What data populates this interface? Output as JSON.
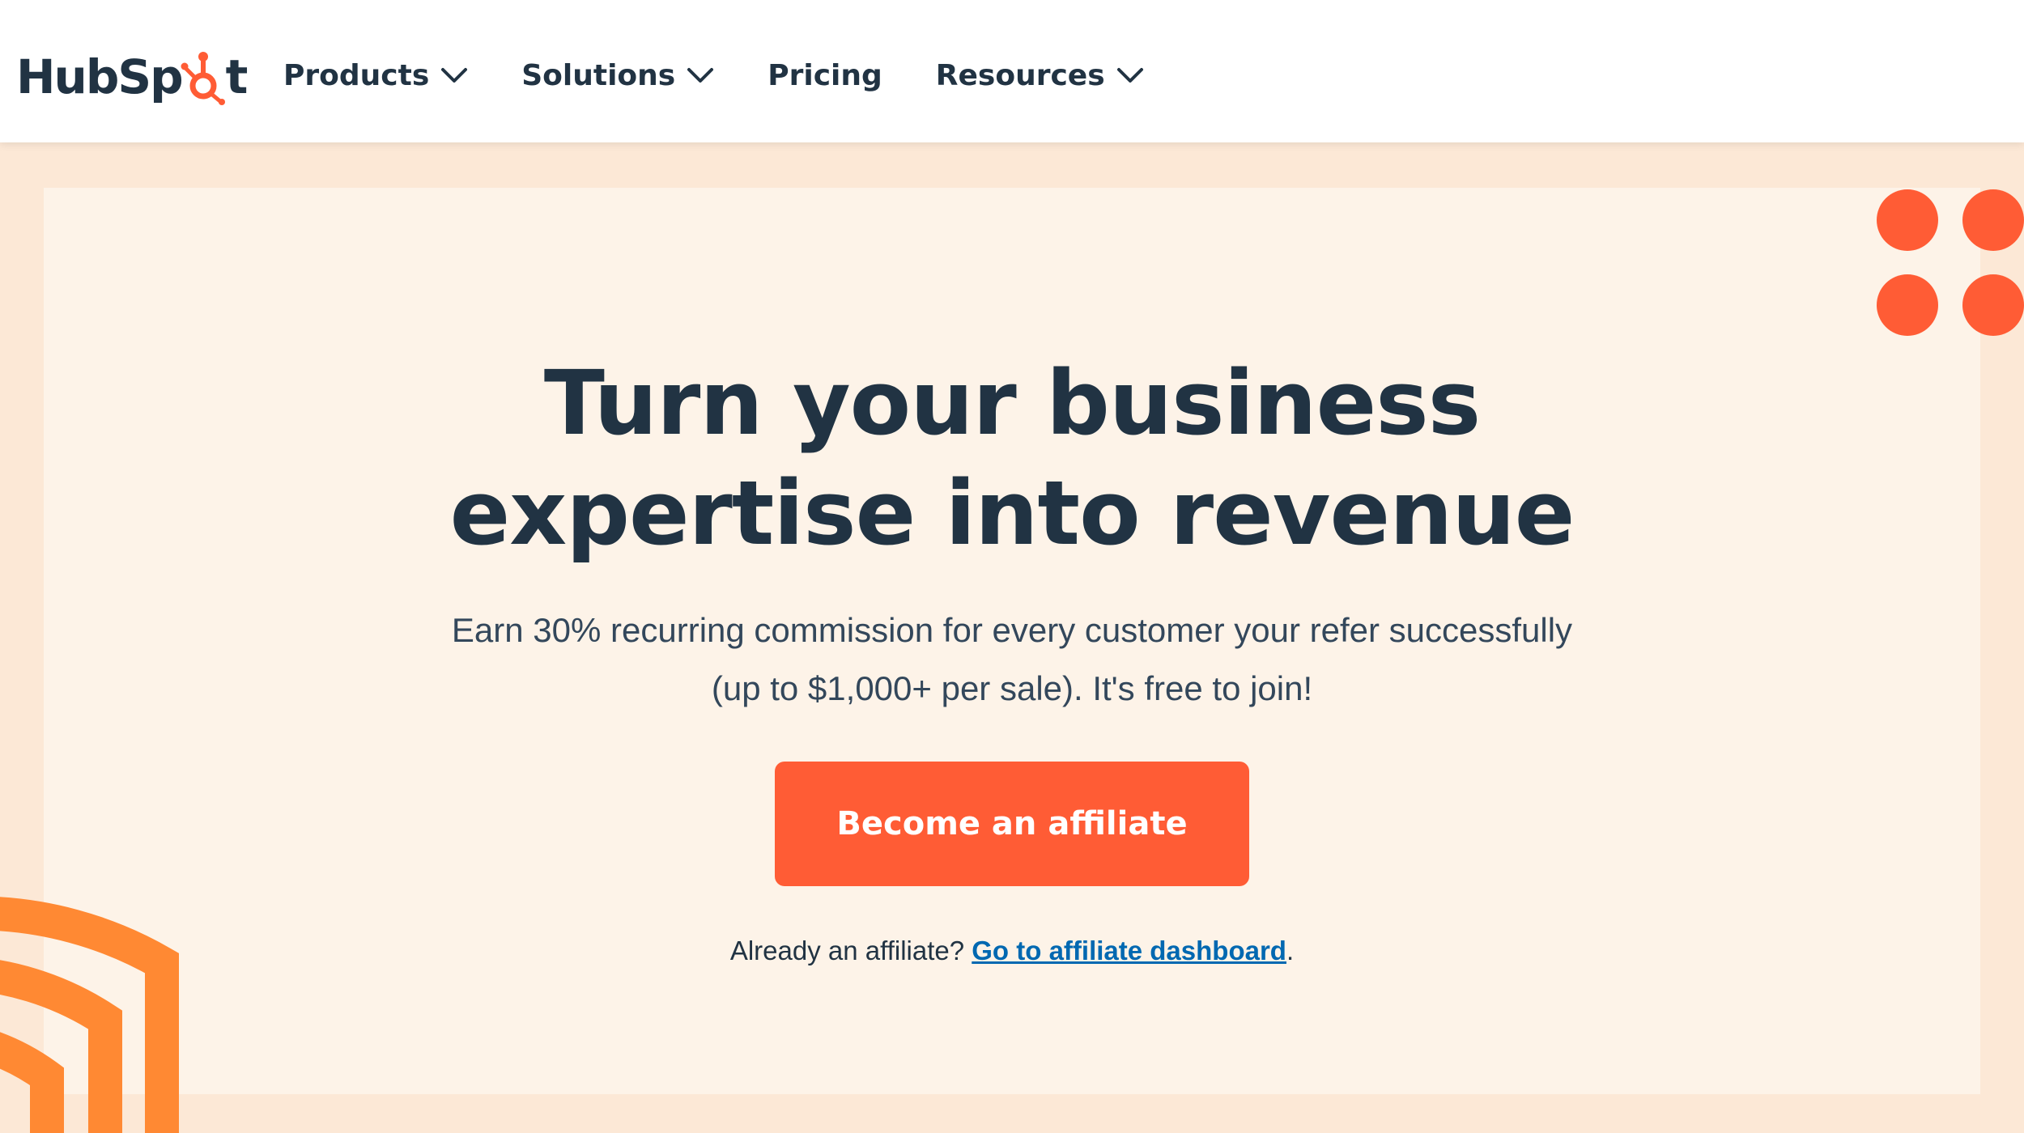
{
  "brand": {
    "logo_text_left": "HubSp",
    "logo_text_right": "t",
    "accent": "#ff5c35",
    "navy": "#213343",
    "link": "#0068b1",
    "arc_orange": "#ff8933"
  },
  "nav": {
    "items": [
      {
        "label": "Products",
        "dropdown": true,
        "icon": "chevron-down-icon"
      },
      {
        "label": "Solutions",
        "dropdown": true,
        "icon": "chevron-down-icon"
      },
      {
        "label": "Pricing",
        "dropdown": false
      },
      {
        "label": "Resources",
        "dropdown": true,
        "icon": "chevron-down-icon"
      }
    ]
  },
  "hero": {
    "title_line1": "Turn your business",
    "title_line2": "expertise into revenue",
    "subtitle_line1": "Earn 30% recurring commission for every customer your refer successfully",
    "subtitle_line2": "(up to $1,000+ per sale). It's free to join!",
    "cta_label": "Become an affiliate",
    "already_text": "Already an affiliate? ",
    "dashboard_link": "Go to affiliate dashboard",
    "period": "."
  }
}
